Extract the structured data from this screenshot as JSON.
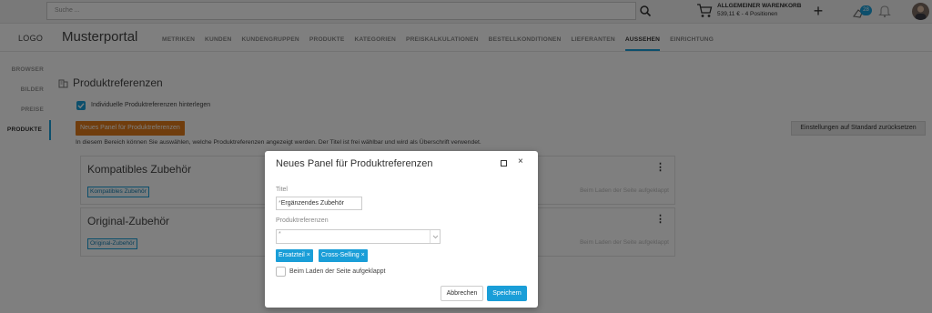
{
  "topbar": {
    "search_placeholder": "Suche ...",
    "cart_title": "ALLGEMEINER WARENKORB",
    "cart_summary": "539,11 € - 4 Positionen",
    "plus": "+",
    "notification_count": "28"
  },
  "header": {
    "logo": "LOGO",
    "portal_name": "Musterportal",
    "nav": [
      {
        "label": "METRIKEN"
      },
      {
        "label": "KUNDEN"
      },
      {
        "label": "KUNDENGRUPPEN"
      },
      {
        "label": "PRODUKTE"
      },
      {
        "label": "KATEGORIEN"
      },
      {
        "label": "PREISKALKULATIONEN"
      },
      {
        "label": "BESTELLKONDITIONEN"
      },
      {
        "label": "LIEFERANTEN"
      },
      {
        "label": "AUSSEHEN"
      },
      {
        "label": "EINRICHTUNG"
      }
    ],
    "active_nav": "AUSSEHEN"
  },
  "sidebar": {
    "items": [
      {
        "label": "BROWSER"
      },
      {
        "label": "BILDER"
      },
      {
        "label": "PREISE"
      },
      {
        "label": "PRODUKTE"
      }
    ],
    "active": "PRODUKTE"
  },
  "main": {
    "title": "Produktreferenzen",
    "individual_checkbox_label": "Individuelle Produktreferenzen hinterlegen",
    "new_panel_button": "Neues Panel für Produktreferenzen",
    "reset_button": "Einstellungen auf Standard zurücksetzen",
    "info_text": "In diesem Bereich können Sie auswählen, welche Produktreferenzen angezeigt werden. Der Titel ist frei wählbar und wird als Überschrift verwendet.",
    "panels": [
      {
        "title": "Kompatibles Zubehör",
        "tag": "Kompatibles Zubehör",
        "expand_label": "Beim Laden der Seite aufgeklappt",
        "menu": "⋮"
      },
      {
        "title": "Original-Zubehör",
        "tag": "Original-Zubehör",
        "expand_label": "Beim Laden der Seite aufgeklappt",
        "menu": "⋮"
      }
    ]
  },
  "modal": {
    "title": "Neues Panel für Produktreferenzen",
    "close": "×",
    "title_label": "Titel",
    "title_value": "Ergänzendes Zubehör",
    "refs_label": "Produktreferenzen",
    "required_marker": "*",
    "selected_tags": [
      "Ersatzteil ×",
      "Cross-Selling ×"
    ],
    "expand_label": "Beim Laden der Seite aufgeklappt",
    "cancel": "Abbrechen",
    "save": "Speichern"
  },
  "colors": {
    "accent": "#1a9ed8",
    "orange": "#e07b1a"
  }
}
